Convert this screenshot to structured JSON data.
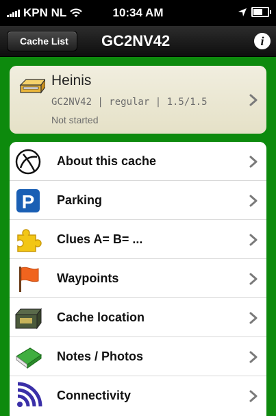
{
  "status_bar": {
    "carrier": "KPN NL",
    "time": "10:34 AM"
  },
  "nav": {
    "back_label": "Cache List",
    "title": "GC2NV42",
    "info_glyph": "i"
  },
  "cache": {
    "icon": "traditional-cache-icon",
    "name": "Heinis",
    "details": "GC2NV42 | regular | 1.5/1.5",
    "state": "Not started"
  },
  "menu": [
    {
      "label": "About this cache",
      "icon": "geocaching-logo-icon"
    },
    {
      "label": "Parking",
      "icon": "parking-icon"
    },
    {
      "label": "Clues A= B= ...",
      "icon": "puzzle-piece-icon"
    },
    {
      "label": "Waypoints",
      "icon": "flag-icon"
    },
    {
      "label": "Cache location",
      "icon": "ammo-box-icon"
    },
    {
      "label": "Notes / Photos",
      "icon": "notebook-icon"
    },
    {
      "label": "Connectivity",
      "icon": "signal-waves-icon"
    }
  ],
  "colors": {
    "background": "#0d8a0d",
    "card": "#ece9d4",
    "parking_blue": "#1a5fb4"
  }
}
